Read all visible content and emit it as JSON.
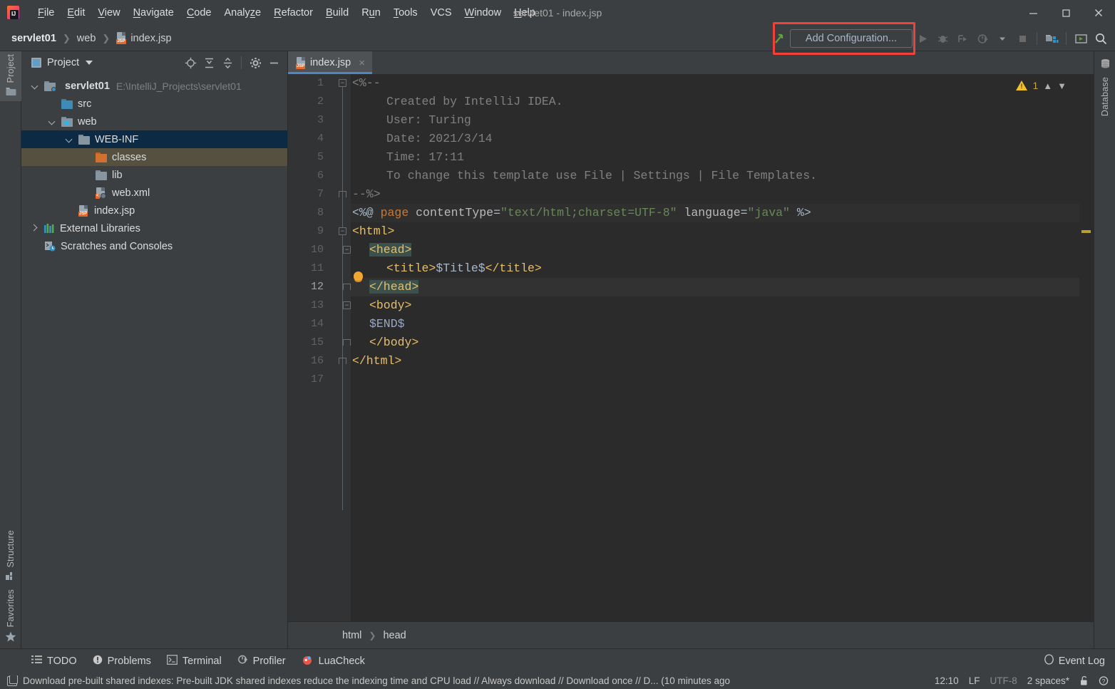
{
  "window": {
    "title": "servlet01 - index.jsp",
    "minimize_label": "Minimize",
    "maximize_label": "Maximize",
    "close_label": "Close"
  },
  "menu": [
    {
      "label": "File",
      "mnemonic": "F"
    },
    {
      "label": "Edit",
      "mnemonic": "E"
    },
    {
      "label": "View",
      "mnemonic": "V"
    },
    {
      "label": "Navigate",
      "mnemonic": "N"
    },
    {
      "label": "Code",
      "mnemonic": "C"
    },
    {
      "label": "Analyze",
      "mnemonic": "z"
    },
    {
      "label": "Refactor",
      "mnemonic": "R"
    },
    {
      "label": "Build",
      "mnemonic": "B"
    },
    {
      "label": "Run",
      "mnemonic": "u"
    },
    {
      "label": "Tools",
      "mnemonic": "T"
    },
    {
      "label": "VCS",
      "mnemonic": ""
    },
    {
      "label": "Window",
      "mnemonic": "W"
    },
    {
      "label": "Help",
      "mnemonic": "H"
    }
  ],
  "navbar": {
    "crumbs": [
      "servlet01",
      "web",
      "index.jsp"
    ],
    "add_configuration_label": "Add Configuration...",
    "icons": [
      "run-icon",
      "debug-icon",
      "run-with-coverage-icon",
      "profiler-icon",
      "dropdown-icon",
      "stop-icon",
      "project-structure-icon",
      "run-console-icon",
      "search-everywhere-icon"
    ]
  },
  "left_tabs": [
    {
      "label": "Project",
      "icon": "folder-icon",
      "active": true
    },
    {
      "label": "Structure",
      "icon": "structure-icon",
      "active": false
    },
    {
      "label": "Favorites",
      "icon": "star-icon",
      "active": false
    }
  ],
  "right_tabs": [
    {
      "label": "Database",
      "icon": "database-icon",
      "active": false
    }
  ],
  "project_panel": {
    "title": "Project",
    "tool_icons": [
      "locate-icon",
      "expand-all-icon",
      "collapse-all-icon",
      "settings-gear-icon",
      "hide-icon"
    ],
    "tree": [
      {
        "label": "servlet01",
        "path": "E:\\IntelliJ_Projects\\servlet01",
        "indent": 0,
        "arrow": "down",
        "icon": "module-folder-icon",
        "bold": true,
        "state": "none"
      },
      {
        "label": "src",
        "path": "",
        "indent": 1,
        "arrow": "none",
        "icon": "source-folder-icon",
        "bold": false,
        "state": "none"
      },
      {
        "label": "web",
        "path": "",
        "indent": 1,
        "arrow": "down",
        "icon": "web-folder-icon",
        "bold": false,
        "state": "none"
      },
      {
        "label": "WEB-INF",
        "path": "",
        "indent": 2,
        "arrow": "down",
        "icon": "folder-icon",
        "bold": false,
        "state": "selected"
      },
      {
        "label": "classes",
        "path": "",
        "indent": 3,
        "arrow": "none",
        "icon": "output-folder-icon",
        "bold": false,
        "state": "highlighted"
      },
      {
        "label": "lib",
        "path": "",
        "indent": 3,
        "arrow": "none",
        "icon": "folder-icon",
        "bold": false,
        "state": "none"
      },
      {
        "label": "web.xml",
        "path": "",
        "indent": 3,
        "arrow": "none",
        "icon": "xml-file-icon",
        "bold": false,
        "state": "none"
      },
      {
        "label": "index.jsp",
        "path": "",
        "indent": 2,
        "arrow": "none",
        "icon": "jsp-file-icon",
        "bold": false,
        "state": "none"
      },
      {
        "label": "External Libraries",
        "path": "",
        "indent": 0,
        "arrow": "right",
        "icon": "libraries-icon",
        "bold": false,
        "state": "none"
      },
      {
        "label": "Scratches and Consoles",
        "path": "",
        "indent": 0,
        "arrow": "none",
        "icon": "scratches-icon",
        "bold": false,
        "state": "none"
      }
    ]
  },
  "editor": {
    "tab": {
      "label": "index.jsp",
      "icon": "jsp-file-icon",
      "close": "×"
    },
    "warning_count": "1",
    "warning_icon": "warning-triangle-icon",
    "prev_icon": "chevron-up-icon",
    "next_icon": "chevron-down-icon",
    "breadcrumb": [
      "html",
      "head"
    ],
    "lines": [
      {
        "n": "1",
        "text": "<%--"
      },
      {
        "n": "2",
        "text": "  Created by IntelliJ IDEA."
      },
      {
        "n": "3",
        "text": "  User: Turing"
      },
      {
        "n": "4",
        "text": "  Date: 2021/3/14"
      },
      {
        "n": "5",
        "text": "  Time: 17:11"
      },
      {
        "n": "6",
        "text": "  To change this template use File | Settings | File Templates."
      },
      {
        "n": "7",
        "text": "--%>"
      },
      {
        "n": "8",
        "text": "<%@ page contentType=\"text/html;charset=UTF-8\" language=\"java\" %>"
      },
      {
        "n": "9",
        "text": "<html>"
      },
      {
        "n": "10",
        "text": "<head>"
      },
      {
        "n": "11",
        "text": "    <title>$Title$</title>"
      },
      {
        "n": "12",
        "text": "</head>"
      },
      {
        "n": "13",
        "text": "<body>"
      },
      {
        "n": "14",
        "text": "$END$"
      },
      {
        "n": "15",
        "text": "</body>"
      },
      {
        "n": "16",
        "text": "</html>"
      },
      {
        "n": "17",
        "text": ""
      }
    ]
  },
  "tool_windows": [
    {
      "label": "TODO",
      "icon": "todo-list-icon"
    },
    {
      "label": "Problems",
      "icon": "problems-icon"
    },
    {
      "label": "Terminal",
      "icon": "terminal-icon"
    },
    {
      "label": "Profiler",
      "icon": "profiler-icon"
    },
    {
      "label": "LuaCheck",
      "icon": "luacheck-icon"
    }
  ],
  "event_log": {
    "label": "Event Log",
    "icon": "event-log-icon"
  },
  "statusbar": {
    "message": "Download pre-built shared indexes: Pre-built JDK shared indexes reduce the indexing time and CPU load // Always download // Download once // D... (10 minutes ago",
    "caret": "12:10",
    "line_sep": "LF",
    "encoding": "UTF-8",
    "indent": "2 spaces*",
    "lock_icon": "unlocked-icon",
    "help_icon": "help-icon"
  },
  "colors": {
    "accent_blue": "#4a88c7",
    "selection_blue": "#0d2a45",
    "highlight_olive": "#55503f",
    "annotation_red": "#f2403a",
    "warning_yellow": "#f0c02a"
  }
}
